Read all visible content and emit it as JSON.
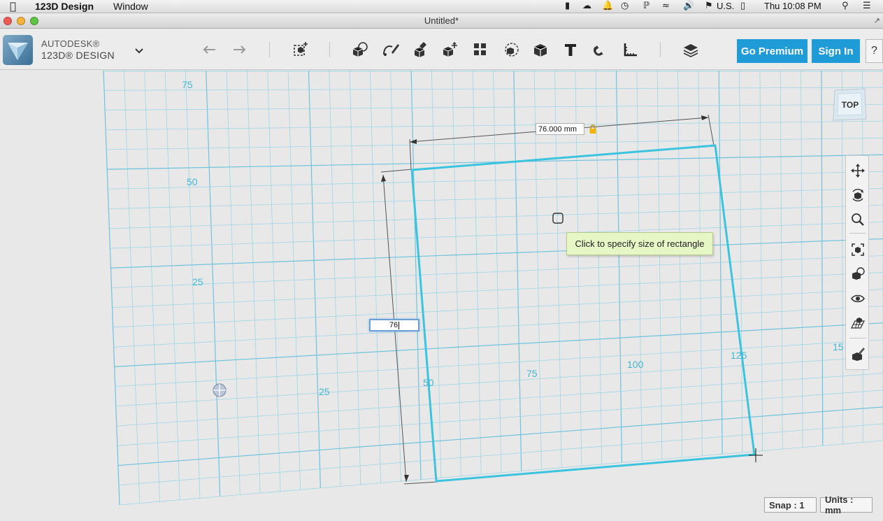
{
  "menubar": {
    "app_name": "123D Design",
    "window_menu": "Window",
    "input_source": "U.S.",
    "clock": "Thu 10:08 PM"
  },
  "window": {
    "title": "Untitled*"
  },
  "brand": {
    "line1": "AUTODESK®",
    "line2": "123D® DESIGN"
  },
  "toolbar": {
    "tools": [
      "undo",
      "redo",
      "transform",
      "primitives",
      "sketch",
      "construct",
      "modify",
      "pattern",
      "grouping",
      "combine",
      "measure-solid",
      "text",
      "snap",
      "measure",
      "materials"
    ],
    "premium_label": "Go Premium",
    "signin_label": "Sign In",
    "help_label": "?"
  },
  "viewport": {
    "grid_labels": {
      "l75": "75",
      "l50": "50",
      "l25": "25",
      "b25": "25",
      "b50": "50",
      "b75": "75",
      "b100": "100",
      "b125": "125",
      "b150": "15"
    },
    "width_value": "76.000 mm",
    "height_input": "76",
    "tooltip": "Click to specify size of rectangle",
    "viewcube_label": "TOP"
  },
  "status": {
    "snap": "Snap : 1",
    "units": "Units : mm"
  },
  "colors": {
    "grid": "#9fd6e6",
    "grid_major": "#6ec3dc",
    "rect": "#3cc4df",
    "accent": "#1f9bd7"
  }
}
